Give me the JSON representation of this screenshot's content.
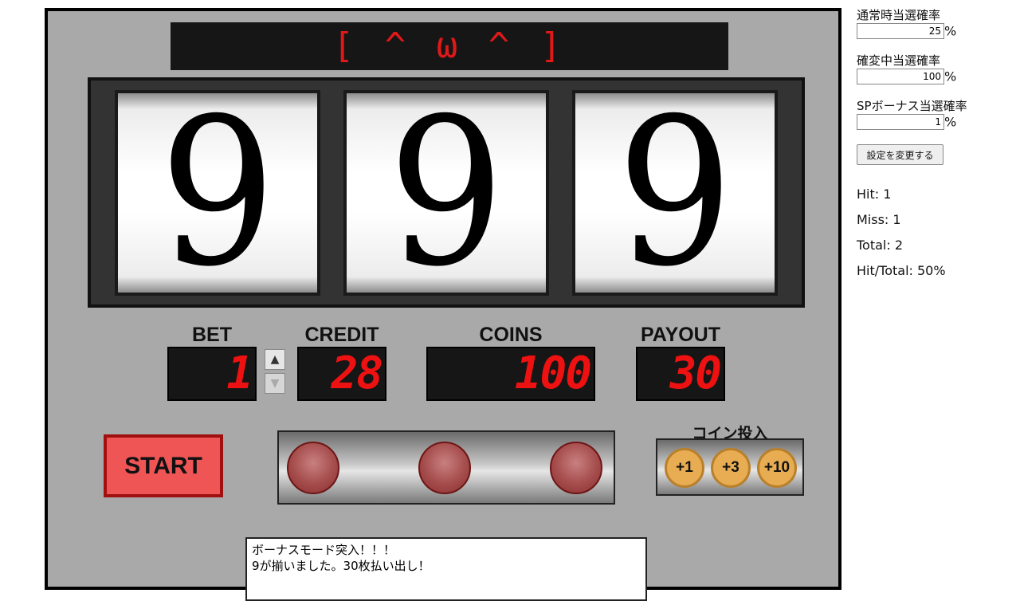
{
  "machine": {
    "face": "[ ^ ω ^ ]",
    "reels": [
      "9",
      "9",
      "9"
    ],
    "meters": {
      "bet": {
        "label": "BET",
        "value": "1"
      },
      "credit": {
        "label": "CREDIT",
        "value": "28"
      },
      "coins": {
        "label": "COINS",
        "value": "100"
      },
      "payout": {
        "label": "PAYOUT",
        "value": "30"
      }
    },
    "bet_up_icon": "triangle-up-icon",
    "bet_down_icon": "triangle-down-icon",
    "start_label": "START",
    "coin_insert": {
      "title": "コイン投入",
      "buttons": [
        "+1",
        "+3",
        "+10"
      ]
    },
    "messages": [
      "ボーナスモード突入！！！",
      "9が揃いました。30枚払い出し！"
    ],
    "colors": {
      "display_bg": "#161616",
      "segment_red": "#ee1111",
      "start_button": "#ef5555",
      "lamp": "#a54c4c",
      "coin": "#e8ad52"
    }
  },
  "settings": {
    "normal": {
      "label": "通常時当選確率",
      "value": "25",
      "unit": "%"
    },
    "kakuhen": {
      "label": "確変中当選確率",
      "value": "100",
      "unit": "%"
    },
    "sp_bonus": {
      "label": "SPボーナス当選確率",
      "value": "1",
      "unit": "%"
    },
    "apply_label": "設定を変更する"
  },
  "stats": {
    "hit": "Hit: 1",
    "miss": "Miss: 1",
    "total": "Total: 2",
    "ratio": "Hit/Total: 50%"
  }
}
